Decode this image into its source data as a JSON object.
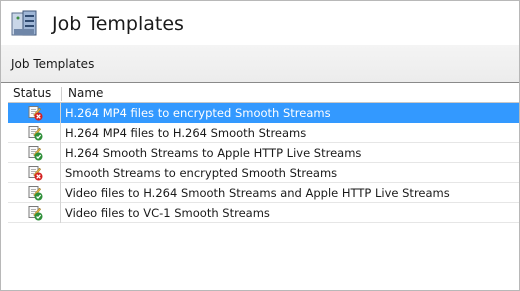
{
  "header": {
    "title": "Job Templates",
    "icon": "server-stack-icon"
  },
  "section": {
    "label": "Job Templates"
  },
  "table": {
    "columns": [
      "Status",
      "Name"
    ],
    "rows": [
      {
        "name": "H.264 MP4 files to encrypted Smooth Streams",
        "status_icon": "template-error-icon",
        "selected": true
      },
      {
        "name": "H.264 MP4 files to H.264 Smooth Streams",
        "status_icon": "template-ok-icon",
        "selected": false
      },
      {
        "name": "H.264 Smooth Streams to Apple HTTP Live Streams",
        "status_icon": "template-ok-icon",
        "selected": false
      },
      {
        "name": "Smooth Streams to encrypted Smooth Streams",
        "status_icon": "template-error-icon",
        "selected": false
      },
      {
        "name": "Video files to H.264 Smooth Streams and Apple HTTP Live Streams",
        "status_icon": "template-ok-icon",
        "selected": false
      },
      {
        "name": "Video files to VC-1 Smooth Streams",
        "status_icon": "template-ok-icon",
        "selected": false
      }
    ]
  },
  "colors": {
    "selection": "#3399ff",
    "error_badge": "#d32020",
    "ok_badge": "#2f8f3a"
  }
}
